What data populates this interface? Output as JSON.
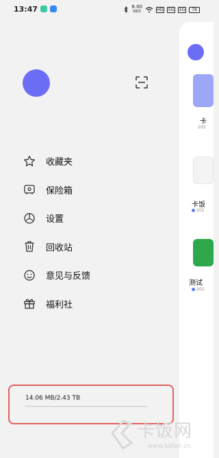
{
  "status_bar": {
    "time": "13:47",
    "net_speed_value": "8.00",
    "net_speed_unit": "KB/S",
    "signal1_label": "5G",
    "signal2_label": "5G",
    "battery_label": "78",
    "wifi_icon": "wifi-icon",
    "hd_label": "HD"
  },
  "drawer": {
    "avatar_icon": "user-avatar",
    "scan_icon": "scan-icon",
    "menu": [
      {
        "label": "收藏夹",
        "icon": "star-icon"
      },
      {
        "label": "保险箱",
        "icon": "safe-box-icon"
      },
      {
        "label": "设置",
        "icon": "settings-icon"
      },
      {
        "label": "回收站",
        "icon": "trash-icon"
      },
      {
        "label": "意见与反馈",
        "icon": "smiley-icon"
      },
      {
        "label": "福利社",
        "icon": "gift-icon"
      }
    ],
    "storage": {
      "text": "14.06 MB/2.43 TB",
      "used_fraction": 5.6e-06
    }
  },
  "panel": {
    "item1_title": "卡",
    "item1_sub": "202",
    "item2_title": "卡饭",
    "item2_sub": "202",
    "item3_title": "测试",
    "item3_sub": "202"
  },
  "watermark": {
    "title": "卡饭网",
    "url": "www.kafan.cn"
  },
  "colors": {
    "accent": "#6b6ef5",
    "highlight_border": "#e0625e",
    "background": "#f2f2f2"
  }
}
